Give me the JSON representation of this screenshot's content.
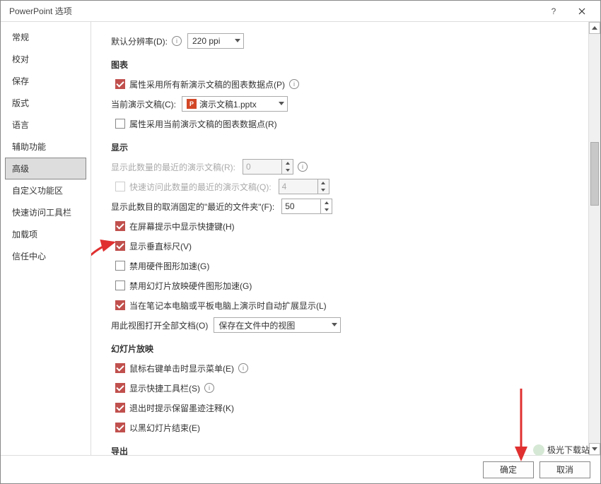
{
  "title": "PowerPoint 选项",
  "sidebar": {
    "items": [
      {
        "label": "常规"
      },
      {
        "label": "校对"
      },
      {
        "label": "保存"
      },
      {
        "label": "版式"
      },
      {
        "label": "语言"
      },
      {
        "label": "辅助功能"
      },
      {
        "label": "高级"
      },
      {
        "label": "自定义功能区"
      },
      {
        "label": "快速访问工具栏"
      },
      {
        "label": "加载项"
      },
      {
        "label": "信任中心"
      }
    ],
    "selected_index": 6
  },
  "content": {
    "default_resolution_label": "默认分辨率(D):",
    "default_resolution_value": "220 ppi",
    "section_chart": "图表",
    "chk_all_new_chart": "属性采用所有新演示文稿的图表数据点(P)",
    "current_presentation_label": "当前演示文稿(C):",
    "current_presentation_value": "演示文稿1.pptx",
    "chk_current_chart": "属性采用当前演示文稿的图表数据点(R)",
    "section_display": "显示",
    "recent_pres_label": "显示此数量的最近的演示文稿(R):",
    "recent_pres_value": "0",
    "quick_recent_label": "快速访问此数量的最近的演示文稿(Q):",
    "quick_recent_value": "4",
    "recent_folders_label": "显示此数目的取消固定的\"最近的文件夹\"(F):",
    "recent_folders_value": "50",
    "chk_screentip": "在屏幕提示中显示快捷键(H)",
    "chk_vruler": "显示垂直标尺(V)",
    "chk_hw_accel": "禁用硬件图形加速(G)",
    "chk_slideshow_hw": "禁用幻灯片放映硬件图形加速(G)",
    "chk_auto_extend": "当在笔记本电脑或平板电脑上演示时自动扩展显示(L)",
    "open_all_view_label": "用此视图打开全部文档(O)",
    "open_all_view_value": "保存在文件中的视图",
    "section_slideshow": "幻灯片放映",
    "chk_rclick_menu": "鼠标右键单击时显示菜单(E)",
    "chk_shortcut_bar": "显示快捷工具栏(S)",
    "chk_ink_exit": "退出时提示保留墨迹注释(K)",
    "chk_black_end": "以黑幻灯片结束(E)",
    "section_export": "导出"
  },
  "footer": {
    "ok": "确定",
    "cancel": "取消"
  },
  "watermark": "极光下载站"
}
